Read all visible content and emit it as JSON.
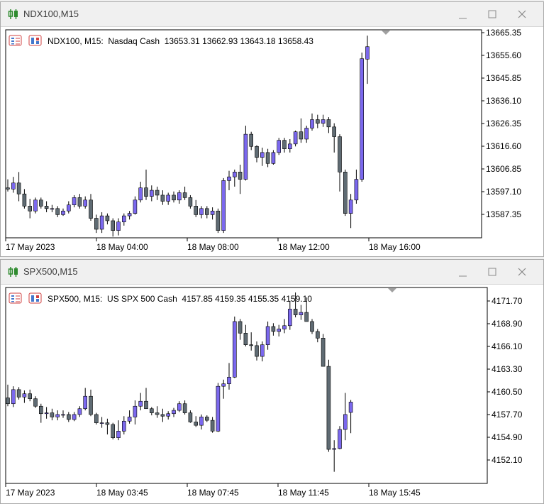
{
  "windows": [
    {
      "title": "NDX100,M15",
      "info": "NDX100, M15:  Nasdaq Cash  13653.31 13662.93 13643.18 13658.43",
      "price_labels": [
        "13665.35",
        "13655.60",
        "13645.85",
        "13636.10",
        "13626.35",
        "13616.60",
        "13606.85",
        "13597.10",
        "13587.35"
      ],
      "time_labels": [
        "17 May 2023",
        "18 May 04:00",
        "18 May 08:00",
        "18 May 12:00",
        "18 May 16:00"
      ],
      "chart_data": {
        "type": "candlestick",
        "symbol": "NDX100",
        "timeframe": "M15",
        "description": "Nasdaq Cash",
        "last_ohlc": [
          13653.31,
          13662.93,
          13643.18,
          13658.43
        ],
        "ylim": [
          13580.0,
          13665.35
        ],
        "bull_color": "#7b68ee",
        "bear_color": "#5f6b73",
        "candles": [
          [
            13600.5,
            13604.0,
            13599.0,
            13600.0
          ],
          [
            13600.0,
            13605.0,
            13598.5,
            13602.5
          ],
          [
            13602.5,
            13607.0,
            13595.0,
            13598.0
          ],
          [
            13598.0,
            13600.0,
            13592.0,
            13593.0
          ],
          [
            13593.0,
            13596.0,
            13588.0,
            13591.0
          ],
          [
            13591.0,
            13596.5,
            13590.0,
            13595.5
          ],
          [
            13595.5,
            13596.5,
            13592.0,
            13593.0
          ],
          [
            13593.0,
            13595.0,
            13590.5,
            13592.0
          ],
          [
            13592.0,
            13593.5,
            13590.5,
            13592.0
          ],
          [
            13592.0,
            13593.0,
            13588.5,
            13589.5
          ],
          [
            13589.5,
            13592.0,
            13589.0,
            13591.0
          ],
          [
            13591.0,
            13595.0,
            13590.0,
            13593.5
          ],
          [
            13593.5,
            13597.5,
            13592.5,
            13596.5
          ],
          [
            13596.5,
            13598.0,
            13592.0,
            13593.0
          ],
          [
            13593.0,
            13597.0,
            13592.0,
            13595.5
          ],
          [
            13595.5,
            13598.0,
            13587.0,
            13588.0
          ],
          [
            13588.0,
            13589.5,
            13582.0,
            13583.5
          ],
          [
            13583.5,
            13590.5,
            13582.0,
            13589.0
          ],
          [
            13589.0,
            13590.0,
            13585.5,
            13587.0
          ],
          [
            13587.0,
            13588.0,
            13580.5,
            13583.0
          ],
          [
            13583.0,
            13588.0,
            13581.0,
            13586.5
          ],
          [
            13586.5,
            13590.0,
            13585.0,
            13589.0
          ],
          [
            13589.0,
            13591.0,
            13587.5,
            13590.0
          ],
          [
            13590.0,
            13597.0,
            13589.5,
            13595.5
          ],
          [
            13595.5,
            13603.0,
            13594.5,
            13600.5
          ],
          [
            13600.5,
            13608.0,
            13595.5,
            13597.0
          ],
          [
            13597.0,
            13601.5,
            13595.0,
            13599.5
          ],
          [
            13599.5,
            13601.0,
            13595.5,
            13597.5
          ],
          [
            13597.5,
            13599.5,
            13593.5,
            13595.0
          ],
          [
            13595.0,
            13598.5,
            13593.5,
            13597.5
          ],
          [
            13597.5,
            13599.0,
            13594.5,
            13595.5
          ],
          [
            13595.5,
            13599.5,
            13594.0,
            13598.5
          ],
          [
            13598.5,
            13601.0,
            13595.5,
            13596.5
          ],
          [
            13596.5,
            13597.5,
            13592.0,
            13593.0
          ],
          [
            13593.0,
            13595.5,
            13588.5,
            13589.5
          ],
          [
            13589.5,
            13593.0,
            13588.0,
            13592.0
          ],
          [
            13592.0,
            13593.0,
            13588.0,
            13589.5
          ],
          [
            13589.5,
            13592.5,
            13587.5,
            13591.0
          ],
          [
            13591.0,
            13592.0,
            13582.0,
            13583.0
          ],
          [
            13583.0,
            13604.5,
            13582.0,
            13603.5
          ],
          [
            13603.5,
            13607.5,
            13599.5,
            13605.0
          ],
          [
            13605.0,
            13608.0,
            13601.0,
            13607.0
          ],
          [
            13607.0,
            13610.0,
            13598.0,
            13604.0
          ],
          [
            13604.0,
            13626.0,
            13603.5,
            13622.5
          ],
          [
            13622.5,
            13623.5,
            13616.0,
            13617.5
          ],
          [
            13617.5,
            13618.0,
            13611.0,
            13613.0
          ],
          [
            13613.0,
            13617.0,
            13609.5,
            13615.0
          ],
          [
            13615.0,
            13616.5,
            13609.0,
            13610.5
          ],
          [
            13610.5,
            13616.0,
            13610.0,
            13615.0
          ],
          [
            13615.0,
            13621.0,
            13614.0,
            13620.0
          ],
          [
            13620.0,
            13621.0,
            13615.0,
            13616.5
          ],
          [
            13616.5,
            13620.5,
            13615.0,
            13618.5
          ],
          [
            13618.5,
            13624.0,
            13617.5,
            13623.5
          ],
          [
            13623.5,
            13629.0,
            13619.0,
            13620.5
          ],
          [
            13620.5,
            13626.0,
            13619.0,
            13625.0
          ],
          [
            13625.0,
            13631.0,
            13624.0,
            13628.5
          ],
          [
            13628.5,
            13630.5,
            13625.0,
            13627.0
          ],
          [
            13627.0,
            13630.5,
            13625.5,
            13628.5
          ],
          [
            13628.5,
            13629.5,
            13623.0,
            13625.5
          ],
          [
            13625.5,
            13627.0,
            13615.0,
            13621.5
          ],
          [
            13621.5,
            13622.5,
            13599.0,
            13607.0
          ],
          [
            13607.0,
            13608.0,
            13589.0,
            13590.0
          ],
          [
            13590.0,
            13598.0,
            13584.0,
            13595.5
          ],
          [
            13595.5,
            13608.0,
            13594.0,
            13604.0
          ],
          [
            13604.0,
            13656.0,
            13603.0,
            13653.5
          ],
          [
            13653.31,
            13662.93,
            13643.18,
            13658.43
          ]
        ]
      }
    },
    {
      "title": "SPX500,M15",
      "info": "SPX500, M15:  US SPX 500 Cash  4157.85 4159.35 4155.35 4159.10",
      "price_labels": [
        "4171.70",
        "4168.90",
        "4166.10",
        "4163.30",
        "4160.50",
        "4157.70",
        "4154.90",
        "4152.10"
      ],
      "time_labels": [
        "17 May 2023",
        "18 May 03:45",
        "18 May 07:45",
        "18 May 11:45",
        "18 May 15:45"
      ],
      "chart_data": {
        "type": "candlestick",
        "symbol": "SPX500",
        "timeframe": "M15",
        "description": "US SPX 500 Cash",
        "last_ohlc": [
          4157.85,
          4159.35,
          4155.35,
          4159.1
        ],
        "ylim": [
          4149.3,
          4172.9
        ],
        "bull_color": "#7b68ee",
        "bear_color": "#5f6b73",
        "candles": [
          [
            4159.6,
            4161.2,
            4158.6,
            4158.9
          ],
          [
            4158.9,
            4161.0,
            4158.5,
            4160.6
          ],
          [
            4160.6,
            4160.9,
            4159.4,
            4159.7
          ],
          [
            4159.7,
            4160.5,
            4159.0,
            4160.1
          ],
          [
            4160.1,
            4160.6,
            4159.2,
            4159.5
          ],
          [
            4159.5,
            4159.8,
            4158.4,
            4158.6
          ],
          [
            4158.6,
            4158.9,
            4156.6,
            4157.7
          ],
          [
            4157.7,
            4158.5,
            4157.1,
            4157.8
          ],
          [
            4157.8,
            4158.3,
            4156.9,
            4157.3
          ],
          [
            4157.3,
            4158.1,
            4156.9,
            4157.6
          ],
          [
            4157.6,
            4158.1,
            4157.2,
            4157.6
          ],
          [
            4157.6,
            4157.9,
            4156.7,
            4157.0
          ],
          [
            4157.0,
            4157.9,
            4156.8,
            4157.6
          ],
          [
            4157.6,
            4158.6,
            4157.3,
            4158.3
          ],
          [
            4158.3,
            4160.8,
            4158.1,
            4159.8
          ],
          [
            4159.8,
            4160.6,
            4157.4,
            4157.6
          ],
          [
            4157.6,
            4157.8,
            4156.4,
            4156.6
          ],
          [
            4156.6,
            4157.3,
            4156.0,
            4156.6
          ],
          [
            4156.6,
            4157.1,
            4155.2,
            4156.4
          ],
          [
            4156.4,
            4156.6,
            4154.6,
            4154.8
          ],
          [
            4154.8,
            4156.9,
            4154.5,
            4155.6
          ],
          [
            4155.6,
            4157.4,
            4155.2,
            4156.8
          ],
          [
            4156.8,
            4158.1,
            4156.5,
            4157.3
          ],
          [
            4157.3,
            4159.3,
            4156.4,
            4158.6
          ],
          [
            4158.6,
            4160.2,
            4158.1,
            4159.2
          ],
          [
            4159.2,
            4160.8,
            4158.9,
            4158.3
          ],
          [
            4158.3,
            4158.5,
            4157.5,
            4157.8
          ],
          [
            4157.8,
            4158.6,
            4157.2,
            4157.6
          ],
          [
            4157.6,
            4158.3,
            4156.7,
            4157.4
          ],
          [
            4157.4,
            4158.0,
            4157.0,
            4157.7
          ],
          [
            4157.7,
            4158.4,
            4157.3,
            4158.1
          ],
          [
            4158.1,
            4159.2,
            4157.9,
            4158.9
          ],
          [
            4158.9,
            4159.3,
            4157.6,
            4157.8
          ],
          [
            4157.8,
            4158.1,
            4156.6,
            4156.7
          ],
          [
            4156.7,
            4157.4,
            4156.1,
            4156.3
          ],
          [
            4156.3,
            4157.6,
            4155.8,
            4157.3
          ],
          [
            4157.3,
            4157.5,
            4156.7,
            4156.9
          ],
          [
            4156.9,
            4157.3,
            4155.4,
            4155.6
          ],
          [
            4155.6,
            4161.4,
            4155.5,
            4161.0
          ],
          [
            4161.0,
            4161.8,
            4159.5,
            4161.3
          ],
          [
            4161.3,
            4163.8,
            4160.6,
            4162.1
          ],
          [
            4162.1,
            4169.4,
            4162.0,
            4168.8
          ],
          [
            4168.8,
            4169.1,
            4166.6,
            4167.4
          ],
          [
            4167.4,
            4168.4,
            4165.8,
            4166.0
          ],
          [
            4166.0,
            4167.5,
            4165.3,
            4165.9
          ],
          [
            4165.9,
            4166.4,
            4164.1,
            4164.6
          ],
          [
            4164.6,
            4166.4,
            4164.0,
            4166.0
          ],
          [
            4166.0,
            4168.8,
            4165.4,
            4168.2
          ],
          [
            4168.2,
            4168.6,
            4167.1,
            4167.6
          ],
          [
            4167.6,
            4168.4,
            4167.0,
            4167.9
          ],
          [
            4167.9,
            4169.1,
            4167.4,
            4168.3
          ],
          [
            4168.3,
            4171.3,
            4167.8,
            4170.3
          ],
          [
            4170.3,
            4172.3,
            4169.3,
            4169.6
          ],
          [
            4169.6,
            4170.8,
            4169.0,
            4169.9
          ],
          [
            4169.9,
            4171.7,
            4169.1,
            4168.8
          ],
          [
            4168.8,
            4169.1,
            4167.3,
            4167.6
          ],
          [
            4167.6,
            4167.9,
            4166.3,
            4166.8
          ],
          [
            4166.8,
            4167.3,
            4164.1,
            4163.4
          ],
          [
            4163.4,
            4164.2,
            4153.1,
            4153.4
          ],
          [
            4153.4,
            4154.5,
            4150.7,
            4153.5
          ],
          [
            4153.5,
            4156.2,
            4153.4,
            4155.8
          ],
          [
            4155.8,
            4160.2,
            4154.5,
            4157.6
          ],
          [
            4157.85,
            4159.35,
            4155.35,
            4159.1
          ]
        ]
      }
    }
  ]
}
